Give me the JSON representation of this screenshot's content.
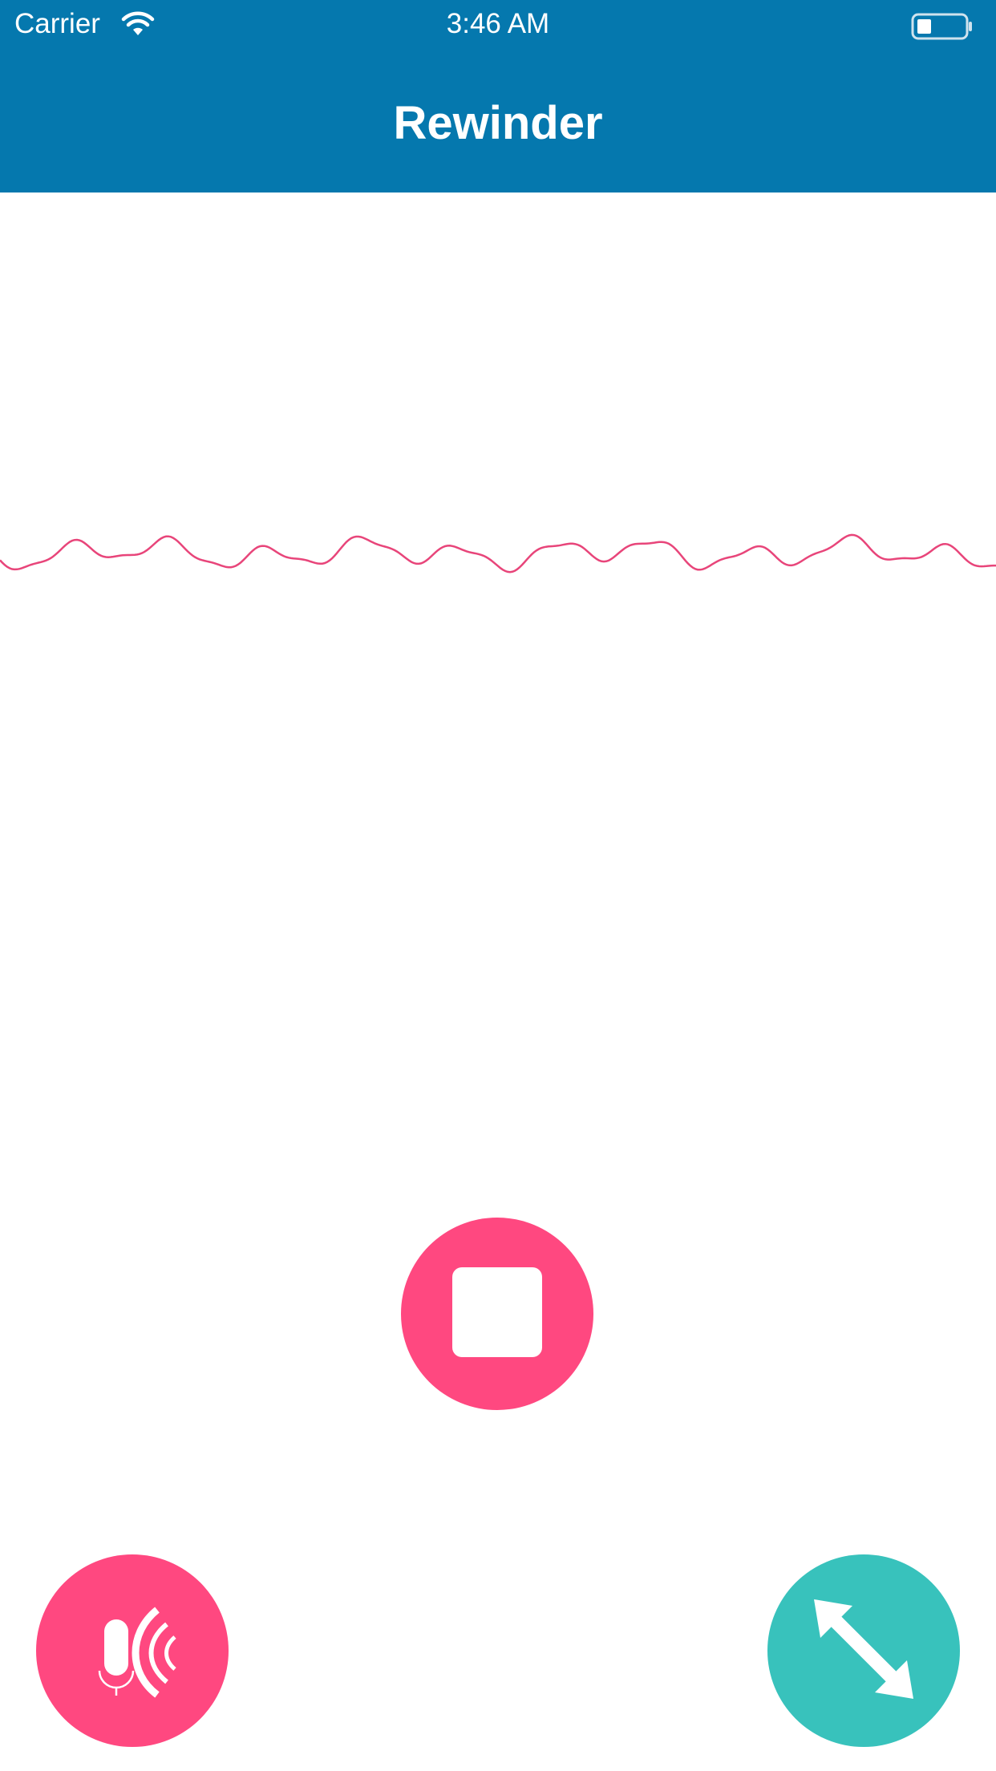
{
  "status_bar": {
    "carrier": "Carrier",
    "time": "3:46 AM",
    "wifi_icon": "wifi-icon",
    "battery_icon": "battery-icon"
  },
  "nav": {
    "title": "Rewinder"
  },
  "waveform": {
    "color": "#e8457a",
    "icon": "waveform"
  },
  "controls": {
    "stop": {
      "icon": "stop-icon",
      "color": "#ff4880"
    },
    "mic": {
      "icon": "microphone-broadcast-icon",
      "color": "#ff4880"
    },
    "expand": {
      "icon": "diagonal-arrows-icon",
      "color": "#38c2bc"
    }
  },
  "colors": {
    "header": "#0578ae",
    "accent_pink": "#ff4880",
    "accent_teal": "#38c2bc"
  }
}
